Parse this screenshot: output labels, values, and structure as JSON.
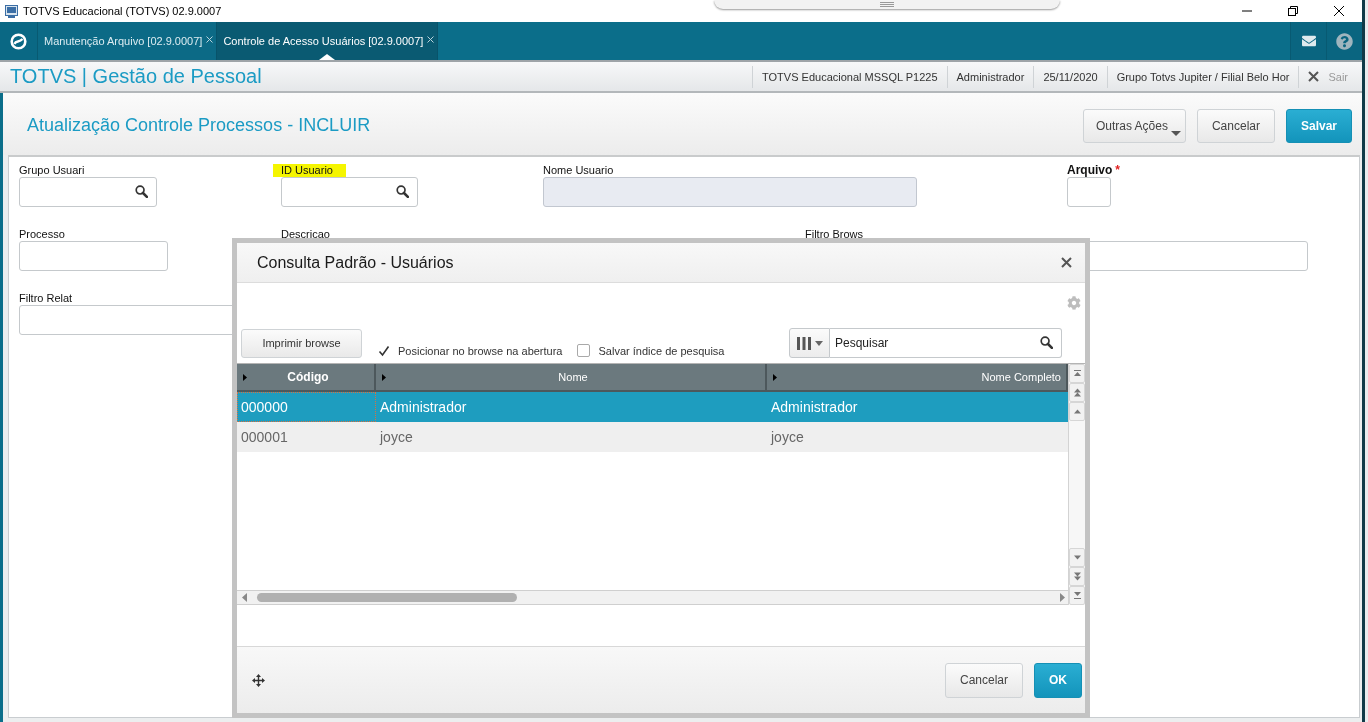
{
  "window": {
    "title": "TOTVS Educacional (TOTVS) 02.9.0007"
  },
  "tabs": [
    {
      "label": "Manutenção Arquivo [02.9.0007]",
      "selected": false
    },
    {
      "label": "Controle de Acesso Usuários [02.9.0007]",
      "selected": true
    }
  ],
  "header": {
    "app_title": "TOTVS | Gestão de Pessoal",
    "info": [
      "TOTVS Educacional MSSQL P1225",
      "Administrador",
      "25/11/2020",
      "Grupo Totvs Jupiter / Filial Belo Hor"
    ],
    "exit": {
      "label": "Sair",
      "disabled": true
    }
  },
  "page": {
    "title": "Atualização Controle Processos - INCLUIR",
    "buttons": [
      {
        "label": "Outras Ações",
        "kind": "menu"
      },
      {
        "label": "Cancelar",
        "kind": "default"
      },
      {
        "label": "Salvar",
        "kind": "primary"
      }
    ]
  },
  "form": {
    "rows": [
      [
        {
          "label": "Grupo Usuari",
          "kind": "lookup",
          "highlighted": false
        },
        {
          "label": "ID Usuario",
          "kind": "lookup",
          "highlighted": true
        },
        {
          "label": "Nome Usuario",
          "kind": "text",
          "highlighted": false,
          "disabled": true
        },
        {
          "label": "Arquivo",
          "kind": "text",
          "required_mark": "*",
          "highlighted": false
        }
      ],
      [
        {
          "label": "Processo",
          "kind": "text",
          "highlighted": false
        },
        {
          "label": "Descricao",
          "kind": "covered",
          "highlighted": false
        },
        {
          "label": "Filtro Brows",
          "kind": "text",
          "highlighted": false
        }
      ],
      [
        {
          "label": "Filtro Relat",
          "kind": "text",
          "highlighted": false
        }
      ]
    ]
  },
  "dialog": {
    "title": "Consulta Padrão - Usuários",
    "print_button": "Imprimir browse",
    "options": [
      {
        "label": "Posicionar no browse na abertura",
        "checked": true
      },
      {
        "label": "Salvar índice de pesquisa",
        "checked": false
      }
    ],
    "search": {
      "placeholder": "Pesquisar"
    },
    "table": {
      "columns": [
        {
          "label": "Código",
          "active": true
        },
        {
          "label": "Nome",
          "active": false
        },
        {
          "label": "Nome Completo",
          "active": false
        }
      ],
      "rows": [
        {
          "cells": [
            "000000",
            "Administrador",
            "Administrador"
          ],
          "selected": true
        },
        {
          "cells": [
            "000001",
            "joyce",
            "joyce"
          ],
          "selected": false
        }
      ]
    },
    "buttons": [
      {
        "label": "Cancelar",
        "kind": "default"
      },
      {
        "label": "OK",
        "kind": "primary"
      }
    ]
  }
}
